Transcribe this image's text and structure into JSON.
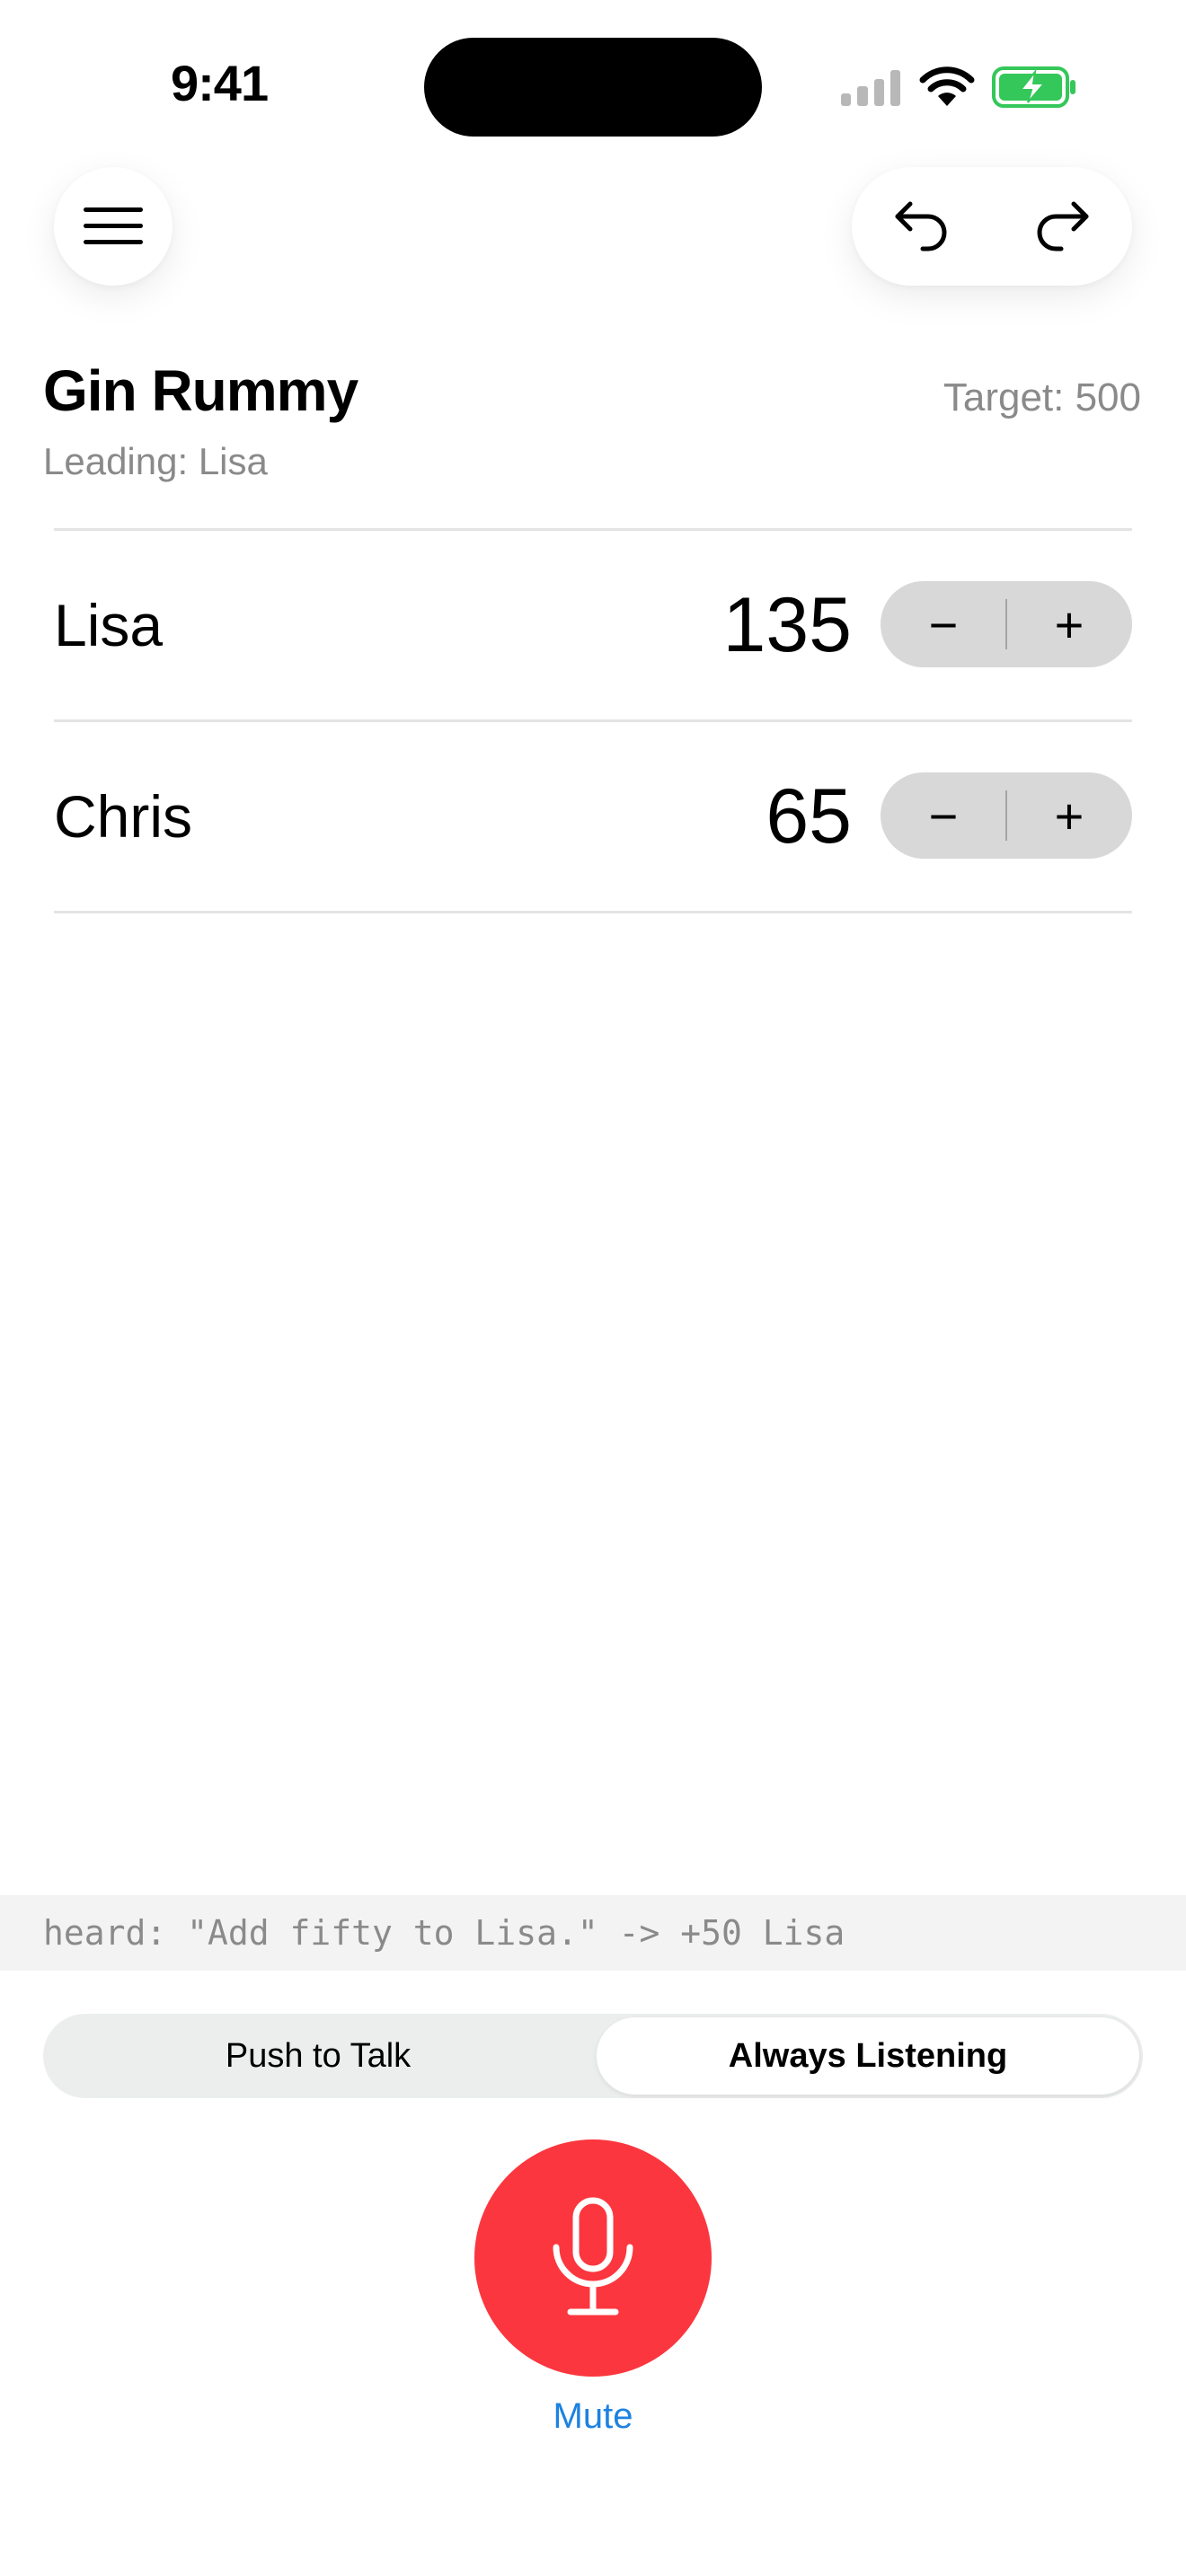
{
  "status_bar": {
    "time": "9:41",
    "signal_icon": "cellular-signal-icon",
    "wifi_icon": "wifi-icon",
    "battery_icon": "battery-charging-icon",
    "battery_color": "#34c759"
  },
  "toolbar": {
    "menu_icon": "hamburger-menu-icon",
    "undo_icon": "undo-arrow-icon",
    "redo_icon": "redo-arrow-icon"
  },
  "header": {
    "title": "Gin Rummy",
    "leading": "Leading: Lisa",
    "target": "Target: 500"
  },
  "players": [
    {
      "name": "Lisa",
      "score": "135",
      "minus": "−",
      "plus": "+"
    },
    {
      "name": "Chris",
      "score": "65",
      "minus": "−",
      "plus": "+"
    }
  ],
  "heard": "heard: \"Add fifty to Lisa.\" -> +50 Lisa",
  "mode": {
    "options": [
      "Push to Talk",
      "Always Listening"
    ],
    "selected": "Always Listening"
  },
  "mic": {
    "icon": "microphone-icon",
    "color": "#fc363e",
    "label": "Mute",
    "label_color": "#1d82e0"
  }
}
